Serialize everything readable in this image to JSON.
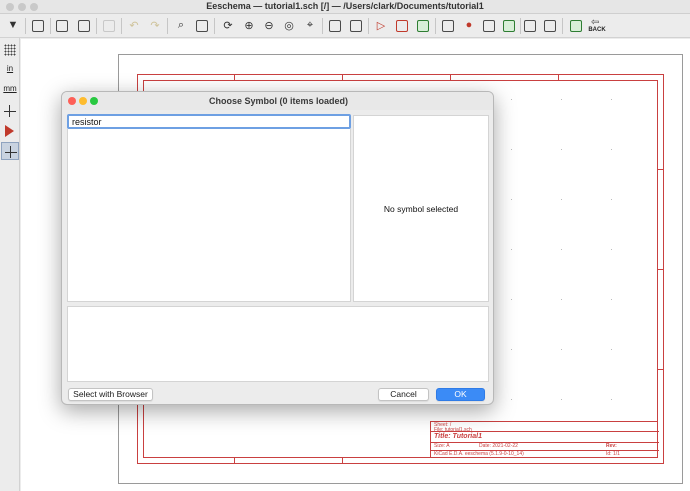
{
  "window": {
    "title": "Eeschema — tutorial1.sch [/] — /Users/clark/Documents/tutorial1"
  },
  "toolbar": {
    "back_label": "BACK"
  },
  "left_toolbar": {
    "units_in": "in",
    "units_mm": "mm"
  },
  "title_block": {
    "sheet": "Sheet: /",
    "file": "File: tutorial1.sch",
    "title": "Title: Tutorial1",
    "size": "Size: A",
    "date": "Date: 2021-02-22",
    "rev": "Rev:",
    "kicad": "KiCad E.D.A.  eeschema (5.1.9-0-10_14)",
    "id": "Id: 1/1"
  },
  "dialog": {
    "title": "Choose Symbol (0 items loaded)",
    "search_value": "resistor",
    "preview_text": "No symbol selected",
    "buttons": {
      "browser": "Select with Browser",
      "cancel": "Cancel",
      "ok": "OK"
    },
    "colors": {
      "ok_accent": "#3b8bf6",
      "close": "#fd5f57",
      "minimize": "#febc2e",
      "zoom": "#28c840"
    }
  }
}
